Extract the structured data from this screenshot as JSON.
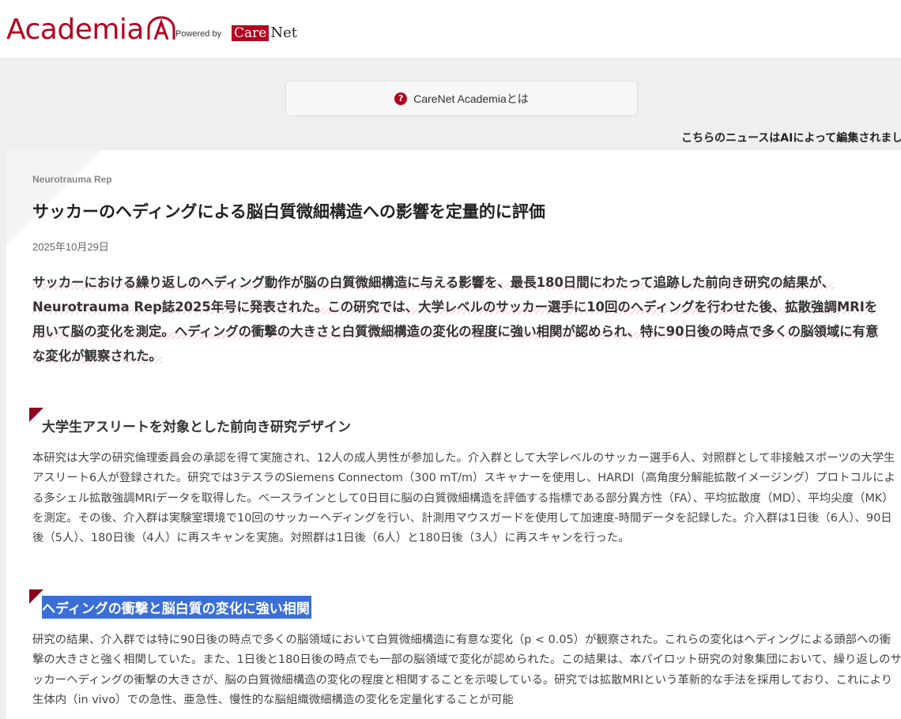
{
  "header": {
    "logo_text": "Academia",
    "powered_by": "Powered by",
    "carenet_care": "Care",
    "carenet_net": "Net"
  },
  "about": {
    "label": "CareNet Academiaとは",
    "icon": "question-circle-icon"
  },
  "ai_note": "こちらのニュースはAIによって編集されまし",
  "article": {
    "journal": "Neurotrauma Rep",
    "title": "サッカーのヘディングによる脳白質微細構造への影響を定量的に評価",
    "date": "2025年10月29日",
    "lead": "サッカーにおける繰り返しのヘディング動作が脳の白質微細構造に与える影響を、最長180日間にわたって追跡した前向き研究の結果が、Neurotrauma Rep誌2025年号に発表された。この研究では、大学レベルのサッカー選手に10回のヘディングを行わせた後、拡散強調MRIを用いて脳の変化を測定。ヘディングの衝撃の大きさと白質微細構造の変化の程度に強い相関が認められ、特に90日後の時点で多くの脳領域に有意な変化が観察された。",
    "sections": [
      {
        "heading": "大学生アスリートを対象とした前向き研究デザイン",
        "body": "本研究は大学の研究倫理委員会の承認を得て実施され、12人の成人男性が参加した。介入群として大学レベルのサッカー選手6人、対照群として非接触スポーツの大学生アスリート6人が登録された。研究では3テスラのSiemens Connectom（300 mT/m）スキャナーを使用し、HARDI（高角度分解能拡散イメージング）プロトコルによる多シェル拡散強調MRIデータを取得した。ベースラインとして0日目に脳の白質微細構造を評価する指標である部分異方性（FA）、平均拡散度（MD）、平均尖度（MK）を測定。その後、介入群は実験室環境で10回のサッカーヘディングを行い、計測用マウスガードを使用して加速度-時間データを記録した。介入群は1日後（6人）、90日後（5人）、180日後（4人）に再スキャンを実施。対照群は1日後（6人）と180日後（3人）に再スキャンを行った。"
      },
      {
        "heading": "ヘディングの衝撃と脳白質の変化に強い相関",
        "body": "研究の結果、介入群では特に90日後の時点で多くの脳領域において白質微細構造に有意な変化（p < 0.05）が観察された。これらの変化はヘディングによる頭部への衝撃の大きさと強く相関していた。また、1日後と180日後の時点でも一部の脳領域で変化が認められた。この結果は、本パイロット研究の対象集団において、繰り返しのサッカーヘディングの衝撃の大きさが、脳の白質微細構造の変化の程度と相関することを示唆している。研究では拡散MRIという革新的な手法を採用しており、これにより生体内（in vivo）での急性、亜急性、慢性的な脳組織微細構造の変化を定量化することが可能"
      }
    ]
  },
  "colors": {
    "brand": "#b5001f",
    "selection": "#3b6fd6"
  }
}
